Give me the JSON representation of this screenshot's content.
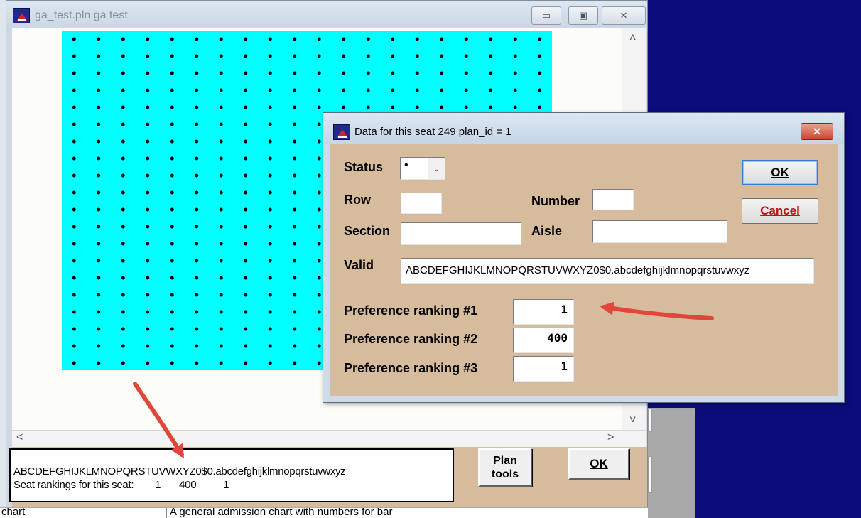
{
  "main_window": {
    "title": "ga_test.pln ga test",
    "minimize_glyph": "▭",
    "maximize_glyph": "▣",
    "close_glyph": "✕"
  },
  "scroll": {
    "up": "˄",
    "down": "˅",
    "left": "<",
    "right": ">"
  },
  "seat_map": {
    "background_color": "#00ffff",
    "dot_color": "#000000"
  },
  "status_panel": {
    "valid_chars": "ABCDEFGHIJKLMNOPQRSTUVWXYZ0$0.abcdefghijklmnopqrstuvwxyz",
    "rankings_label": "Seat rankings for this seat:",
    "rankings": [
      "1",
      "400",
      "1"
    ]
  },
  "buttons": {
    "plan_tools_line1": "Plan",
    "plan_tools_line2": "tools",
    "ok": "OK"
  },
  "bottom_row": {
    "left_text": "chart",
    "right_text": "A general admission chart with numbers for bar"
  },
  "dialog": {
    "title": "Data for this seat  249 plan_id = 1",
    "close_glyph": "✕",
    "status_label": "Status",
    "status_value": "•",
    "row_label": "Row",
    "row_value": "",
    "number_label": "Number",
    "number_value": "",
    "section_label": "Section",
    "section_value": "",
    "aisle_label": "Aisle",
    "aisle_value": "",
    "valid_label": "Valid",
    "valid_value": "ABCDEFGHIJKLMNOPQRSTUVWXYZ0$0.abcdefghijklmnopqrstuvwxyz",
    "pref1_label": "Preference ranking #1",
    "pref1_value": "1",
    "pref2_label": "Preference ranking #2",
    "pref2_value": "400",
    "pref3_label": "Preference ranking #3",
    "pref3_value": "1",
    "ok_label": "OK",
    "cancel_label": "Cancel"
  },
  "colors": {
    "desktop": "#0b0b7c",
    "panel_tan": "#d6bc9d",
    "annotation_arrow": "#e0463a"
  }
}
